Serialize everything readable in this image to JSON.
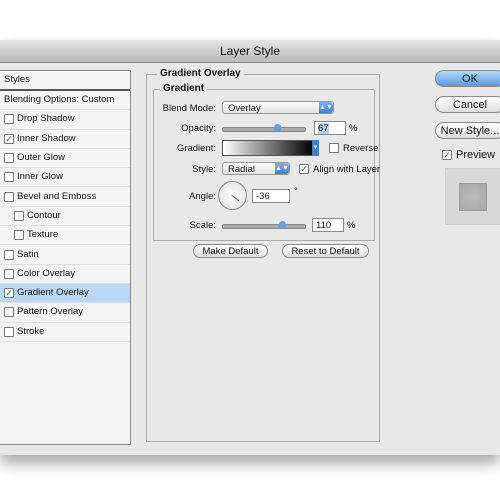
{
  "window": {
    "title": "Layer Style"
  },
  "styles_list": {
    "header": "Styles",
    "blending": "Blending Options: Custom",
    "items": [
      {
        "label": "Drop Shadow",
        "checked": false,
        "sub": false
      },
      {
        "label": "Inner Shadow",
        "checked": true,
        "sub": false
      },
      {
        "label": "Outer Glow",
        "checked": false,
        "sub": false
      },
      {
        "label": "Inner Glow",
        "checked": false,
        "sub": false
      },
      {
        "label": "Bevel and Emboss",
        "checked": false,
        "sub": false
      },
      {
        "label": "Contour",
        "checked": false,
        "sub": true
      },
      {
        "label": "Texture",
        "checked": false,
        "sub": true
      },
      {
        "label": "Satin",
        "checked": false,
        "sub": false
      },
      {
        "label": "Color Overlay",
        "checked": false,
        "sub": false
      },
      {
        "label": "Gradient Overlay",
        "checked": true,
        "sub": false,
        "selected": true
      },
      {
        "label": "Pattern Overlay",
        "checked": false,
        "sub": false
      },
      {
        "label": "Stroke",
        "checked": false,
        "sub": false
      }
    ]
  },
  "panel": {
    "title": "Gradient Overlay",
    "group": "Gradient",
    "blend_mode_label": "Blend Mode:",
    "blend_mode": "Overlay",
    "opacity_label": "Opacity:",
    "opacity": "67",
    "opacity_unit": "%",
    "opacity_fraction": 0.67,
    "gradient_label": "Gradient:",
    "reverse_label": "Reverse",
    "reverse": false,
    "style_label": "Style:",
    "style": "Radial",
    "align_label": "Align with Layer",
    "align": true,
    "angle_label": "Angle:",
    "angle": "-36",
    "angle_unit": "°",
    "scale_label": "Scale:",
    "scale": "110",
    "scale_unit": "%",
    "scale_fraction": 0.73,
    "make_default": "Make Default",
    "reset_default": "Reset to Default"
  },
  "buttons": {
    "ok": "OK",
    "cancel": "Cancel",
    "new_style": "New Style...",
    "preview_label": "Preview",
    "preview": true
  },
  "colors": {
    "accent": "#3f7fd0",
    "selected_row": "#bcd6f5"
  }
}
